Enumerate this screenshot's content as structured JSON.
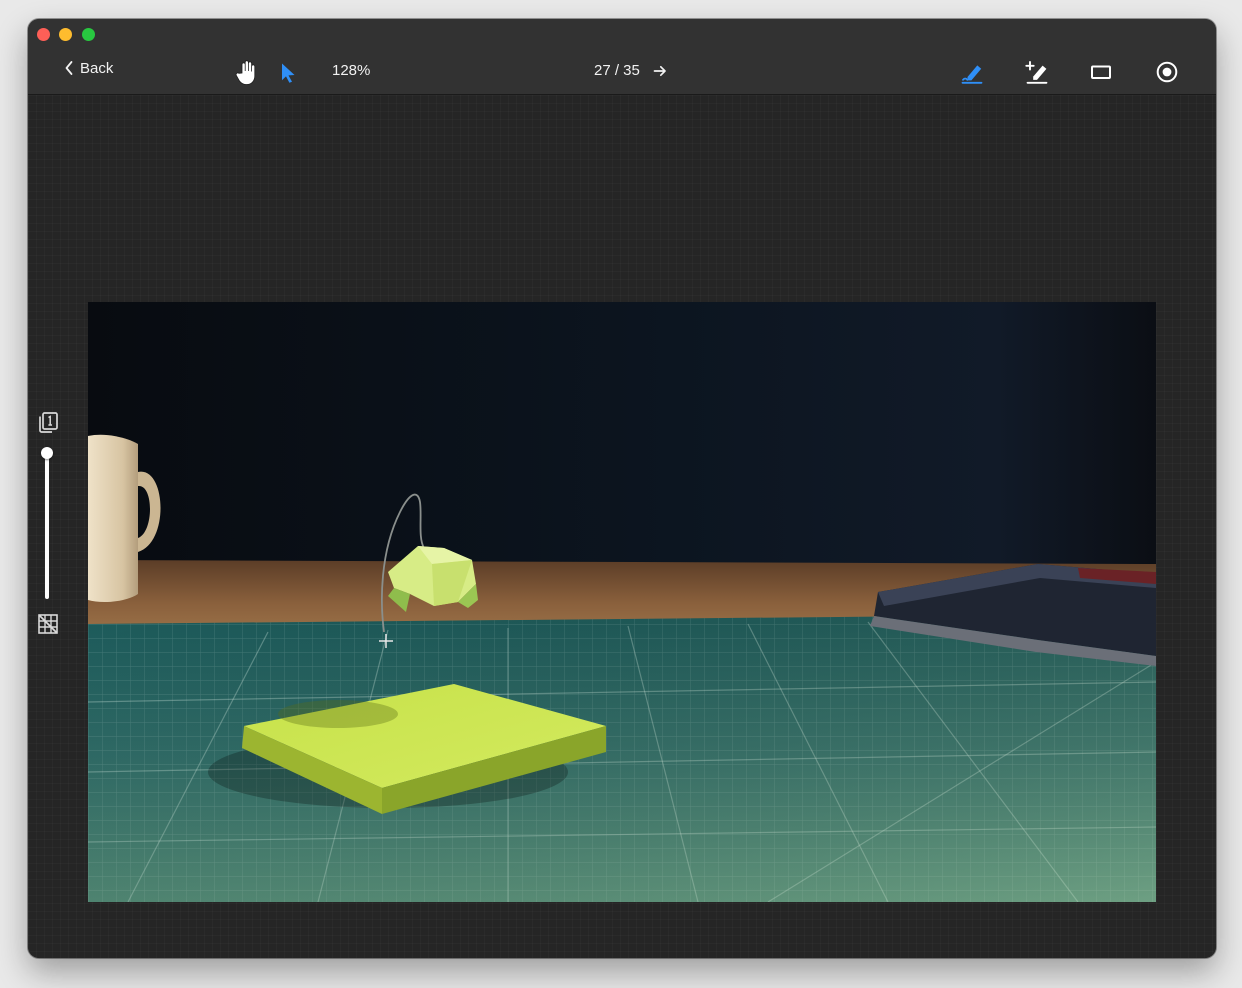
{
  "toolbar": {
    "back_label": "Back",
    "zoom_label": "128%",
    "page_current": "27",
    "page_total": "35",
    "page_label": "27 / 35"
  },
  "icons": {
    "back": "chevron-left-icon",
    "hand": "hand-icon",
    "pointer": "pointer-icon",
    "next": "arrow-right-icon",
    "edit_active": "pen-edit-icon",
    "edit_add": "pen-add-icon",
    "frame": "rectangle-icon",
    "record": "record-icon",
    "pages": "pages-icon",
    "grid": "grid-icon"
  },
  "colors": {
    "accent": "#2f8ff7",
    "titlebar": "#323232",
    "canvas": "#252525"
  },
  "slider": {
    "value": 1.0
  }
}
